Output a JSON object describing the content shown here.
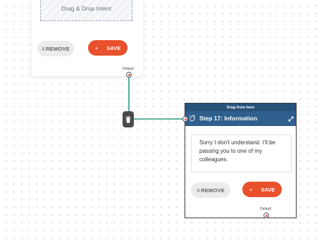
{
  "top_card": {
    "drop_zone_text": "Drag & Drop Intent",
    "remove_label": "REMOVE",
    "remove_prefix": "X",
    "save_label": "SAVE",
    "save_prefix": "+",
    "port_label": "Default"
  },
  "step_card": {
    "drag_label": "Drag from here",
    "title": "Step 17: Information",
    "message": "Sorry I don't understand. I'll be passing you to one of my colleagues.",
    "remove_label": "REMOVE",
    "remove_prefix": "X",
    "save_label": "SAVE",
    "save_prefix": "+",
    "port_label": "Default"
  },
  "icons": {
    "connector_handle": "trash-icon",
    "step_type": "waving-hand-icon",
    "expand": "expand-arrows-icon"
  },
  "colors": {
    "save_button": "#e8512c",
    "remove_button": "#ececec",
    "header": "#2f5f8d",
    "connector": "#2f9a86",
    "port_dot": "#e8512c"
  }
}
